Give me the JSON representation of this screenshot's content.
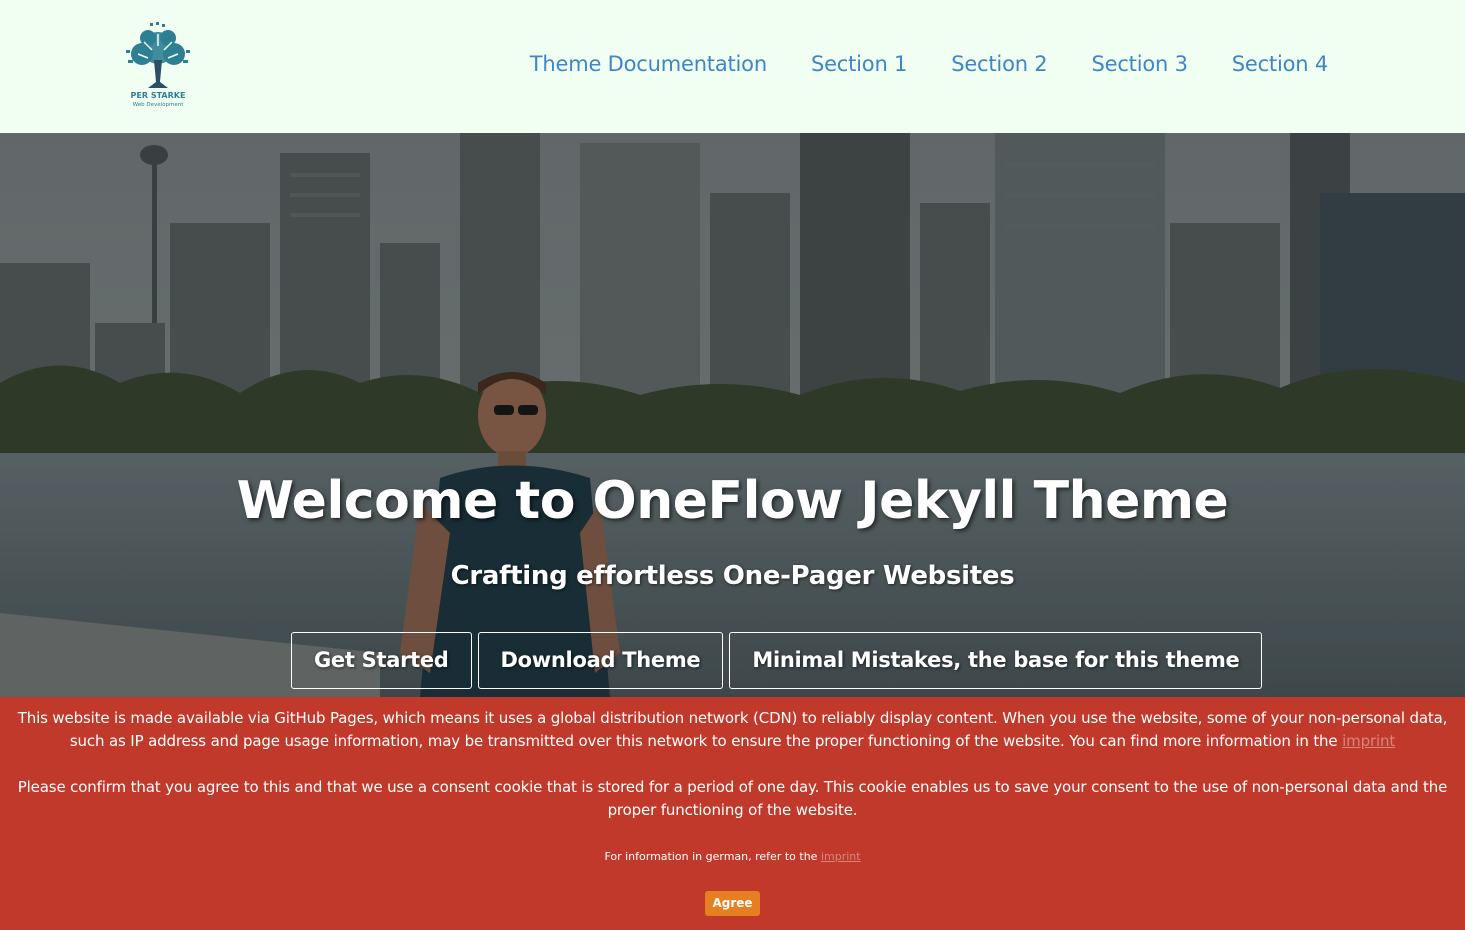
{
  "header": {
    "logo_text": "PER STARKE",
    "logo_subtext": "Web Development",
    "nav": [
      {
        "label": "Theme Documentation"
      },
      {
        "label": "Section 1"
      },
      {
        "label": "Section 2"
      },
      {
        "label": "Section 3"
      },
      {
        "label": "Section 4"
      }
    ]
  },
  "hero": {
    "title": "Welcome to OneFlow Jekyll Theme",
    "subtitle": "Crafting effortless One-Pager Websites",
    "buttons": [
      {
        "label": "Get Started"
      },
      {
        "label": "Download Theme"
      },
      {
        "label": "Minimal Mistakes, the base for this theme"
      }
    ]
  },
  "consent": {
    "paragraph1": "This website is made available via GitHub Pages, which means it uses a global distribution network (CDN) to reliably display content. When you use the website, some of your non-personal data, such as IP address and page usage information, may be transmitted over this network to ensure the proper functioning of the website. You can find more information in the",
    "paragraph1_link": "imprint",
    "paragraph2": "Please confirm that you agree to this and that we use a consent cookie that is stored for a period of one day. This cookie enables us to save your consent to the use of non-personal data and the proper functioning of the website.",
    "german_note": "For information in german, refer to the",
    "german_link": "imprint",
    "agree_label": "Agree"
  },
  "colors": {
    "header_bg": "#f0fff1",
    "nav_link": "#3f86c7",
    "banner_bg": "#c0392b",
    "agree_bg": "#e67e22"
  },
  "icons": {
    "logo": "tree-circuit-logo"
  }
}
